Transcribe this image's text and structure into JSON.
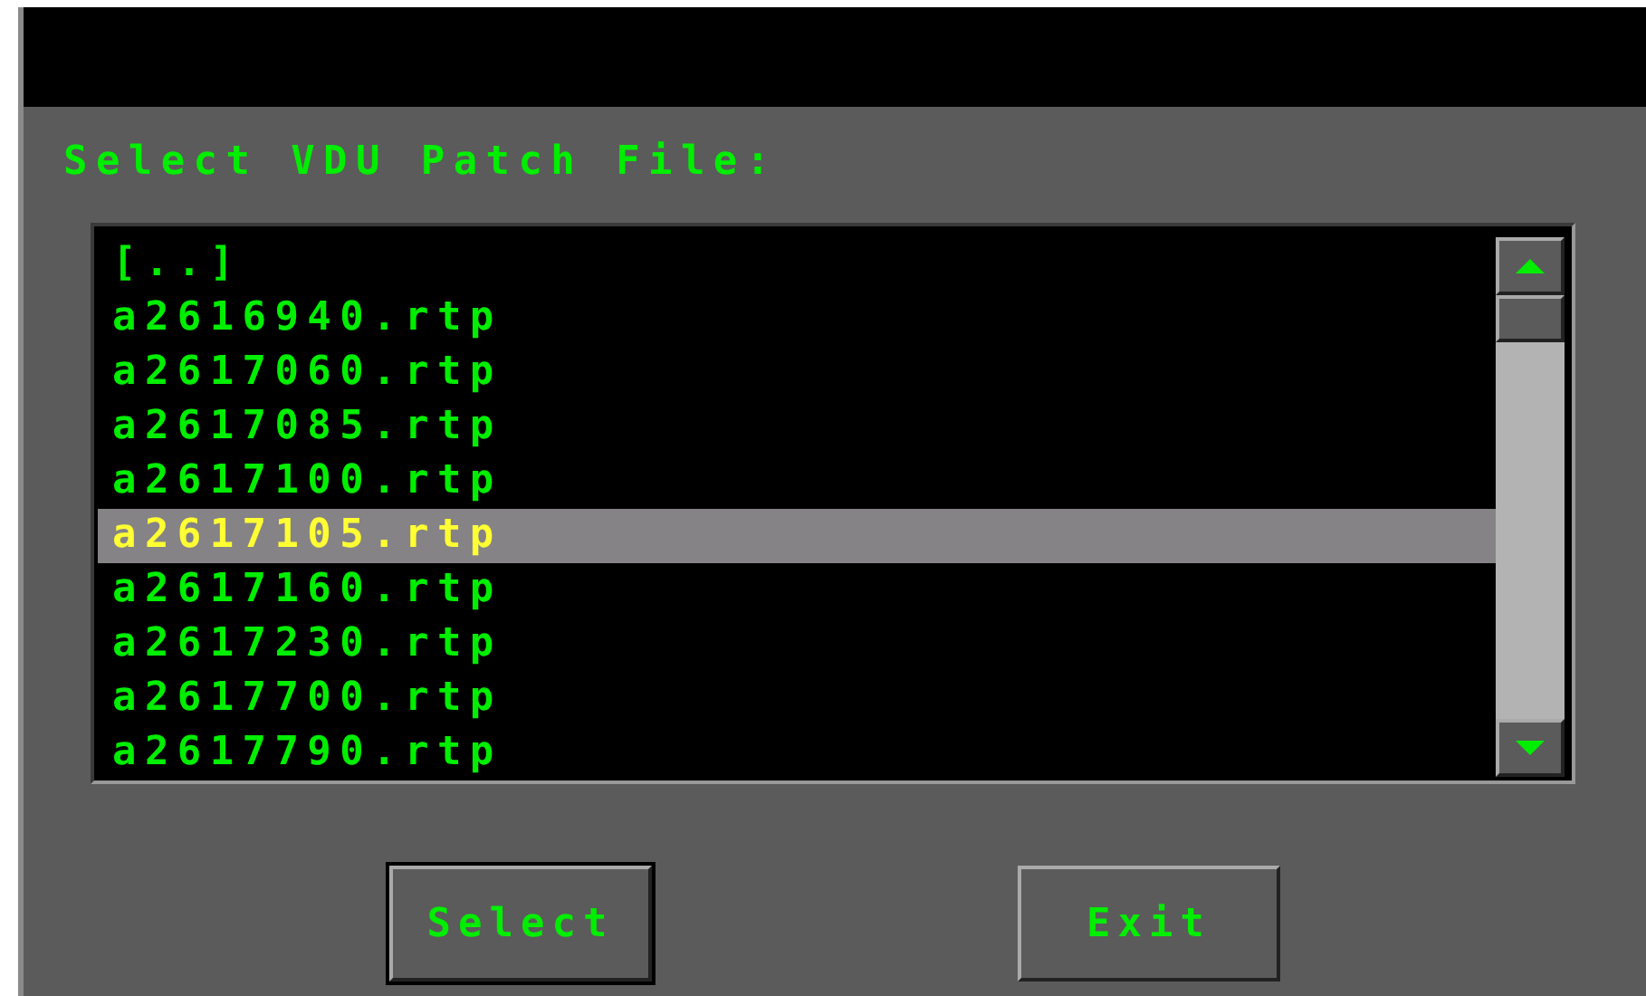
{
  "prompt": "Select VDU Patch File:",
  "files": [
    {
      "name": "[..]",
      "selected": false
    },
    {
      "name": "a2616940.rtp",
      "selected": false
    },
    {
      "name": "a2617060.rtp",
      "selected": false
    },
    {
      "name": "a2617085.rtp",
      "selected": false
    },
    {
      "name": "a2617100.rtp",
      "selected": false
    },
    {
      "name": "a2617105.rtp",
      "selected": true
    },
    {
      "name": "a2617160.rtp",
      "selected": false
    },
    {
      "name": "a2617230.rtp",
      "selected": false
    },
    {
      "name": "a2617700.rtp",
      "selected": false
    },
    {
      "name": "a2617790.rtp",
      "selected": false
    }
  ],
  "buttons": [
    {
      "label": "Select",
      "focused": true
    },
    {
      "label": "Exit",
      "focused": false
    }
  ]
}
